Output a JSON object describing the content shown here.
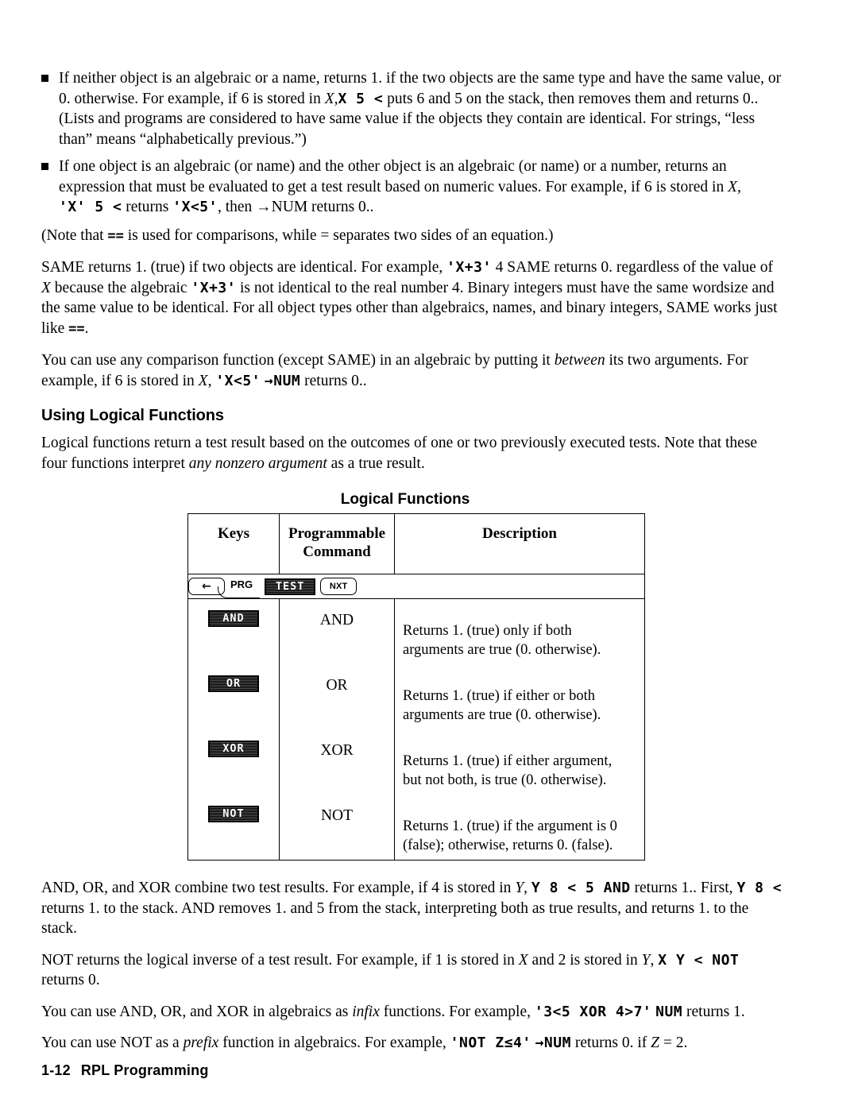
{
  "page": {
    "footer_page_number": "1-12",
    "footer_title": "RPL Programming"
  },
  "bullets": [
    {
      "id": "bullet-neither-algebraic",
      "part1": "If neither object is an algebraic or a name, returns 1. if the two objects are the same type and have the same value, or 0. otherwise. For example, if 6 is stored in ",
      "var1": "X",
      "code1": "X 5 <",
      "part2": " puts 6 and 5 on the stack, then removes them and returns 0.. (Lists and programs are considered to have same value if the objects they contain are identical. For strings, “less than” means “alphabetically previous.”)"
    },
    {
      "id": "bullet-one-algebraic",
      "part1": "If one object is an algebraic (or name) and the other object is an algebraic (or name) or  a number, returns an expression that must be evaluated to get a test result based on numeric values. For example, if 6 is stored in ",
      "var1": "X",
      "part2": ", ",
      "code1": "'X' 5 <",
      "part3": " returns ",
      "code2": "'X<5'",
      "part4": ", then →NUM returns 0.."
    }
  ],
  "paragraphs": {
    "note_equals": {
      "part1": "(Note that ",
      "code1": "==",
      "part2": " is used for comparisons, while = separates two sides of an equation.)"
    },
    "same_returns": {
      "part1": "SAME returns 1. (true) if two objects are identical. For example, ",
      "code1": "'X+3'",
      "part2": " 4 SAME returns 0. regardless of the value of ",
      "var1": "X",
      "part3": " because the algebraic ",
      "code2": "'X+3'",
      "part4": " is not identical to the real number 4. Binary integers must have the same wordsize and the same value to be identical. For all object types other than algebraics, names, and binary integers, SAME works just like ",
      "code3": "==",
      "part5": "."
    },
    "comparison_infix": {
      "part1": "You can use any comparison function (except SAME) in an algebraic by putting it ",
      "em1": "between",
      "part2": " its two arguments. For example, if 6 is stored in ",
      "var1": "X",
      "part3": ", ",
      "code1": "'X<5'",
      "part4": " ",
      "code2": "→NUM",
      "part5": " returns 0.."
    },
    "logical_intro": " Logical functions return a test result based on the outcomes of one or two previously executed tests. Note that these four functions interpret ",
    "logical_intro_em": "any nonzero argument",
    "logical_intro_end": " as a true result.",
    "and_or_xor": {
      "part1": "AND, OR, and XOR combine two test results. For example, if 4 is stored in ",
      "var1": "Y",
      "part2": ", ",
      "code1": "Y 8 < 5 AND",
      "part3": " returns 1.. First, ",
      "code2": "Y 8 <",
      "part4": " returns 1. to the stack. AND removes 1. and 5 from the stack, interpreting both as true results, and returns 1. to the stack."
    },
    "not_inverse": {
      "part1": "NOT returns the logical inverse of a test result. For example, if 1 is stored in ",
      "var1": "X",
      "part2": " and 2 is stored in ",
      "var2": "Y",
      "part3": ", ",
      "code1": "X Y < NOT",
      "part4": " returns 0."
    },
    "infix_algebraics": {
      "part1": "You can use AND, OR, and XOR in algebraics as ",
      "em1": "infix",
      "part2": " functions. For example, ",
      "code1": "'3<5 XOR 4>7'",
      "part3": " ",
      "code2": "NUM",
      "part4": " returns 1."
    },
    "prefix_algebraics": {
      "part1": "You can use NOT as a ",
      "em1": "prefix",
      "part2": " function in algebraics. For example, ",
      "code1": "'NOT Z≤4'",
      "part3": " ",
      "code2": "→NUM",
      "part4": "  returns 0. if ",
      "var1": "Z",
      "part5": " = 2."
    }
  },
  "section_heading": "Using Logical Functions",
  "table": {
    "title": "Logical Functions",
    "headers": {
      "keys": "Keys",
      "command_line1": "Programmable",
      "command_line2": "Command",
      "description": "Description"
    },
    "key_path": {
      "shift_glyph": "←",
      "prg_label": "PRG",
      "menu_key": "TEST",
      "nxt_key": "NXT"
    },
    "rows": [
      {
        "menu_key": "AND",
        "command": "AND",
        "description_line1": "Returns 1. (true) only if both",
        "description_line2": "arguments are true (0. otherwise)."
      },
      {
        "menu_key": "OR",
        "command": "OR",
        "description_line1": "Returns 1. (true) if either or both",
        "description_line2": "arguments are true (0. otherwise)."
      },
      {
        "menu_key": "XOR",
        "command": "XOR",
        "description_line1": "Returns 1. (true) if either argument,",
        "description_line2": "but not both, is true (0. otherwise)."
      },
      {
        "menu_key": "NOT",
        "command": "NOT",
        "description_line1": "Returns 1. (true) if the argument is 0",
        "description_line2": "(false); otherwise, returns 0. (false)."
      }
    ]
  }
}
